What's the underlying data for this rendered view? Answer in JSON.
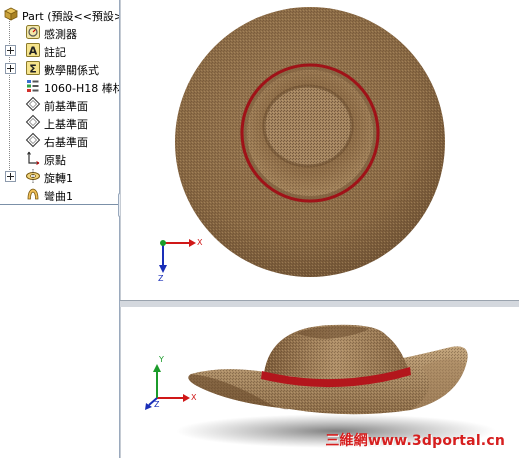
{
  "feature_tree": {
    "root_label": "Part (預設<<預設>",
    "items": [
      {
        "label": "感測器",
        "icon": "sensor-icon"
      },
      {
        "label": "註記",
        "icon": "annotation-icon"
      },
      {
        "label": "數學關係式",
        "icon": "equation-icon"
      },
      {
        "label": "1060-H18 棒材",
        "icon": "material-icon"
      },
      {
        "label": "前基準面",
        "icon": "plane-icon"
      },
      {
        "label": "上基準面",
        "icon": "plane-icon"
      },
      {
        "label": "右基準面",
        "icon": "plane-icon"
      },
      {
        "label": "原點",
        "icon": "origin-icon"
      },
      {
        "label": "旋轉1",
        "icon": "revolve-icon"
      },
      {
        "label": "彎曲1",
        "icon": "flex-icon"
      }
    ]
  },
  "top_view": {
    "triad": {
      "x": "X",
      "z": "Z"
    }
  },
  "iso_view": {
    "triad": {
      "x": "X",
      "y": "Y",
      "z": "Z"
    }
  },
  "watermark": "三維網www.3dportal.cn",
  "colors": {
    "straw": "#8f6a42",
    "band": "#b3161c",
    "axis_x": "#d01818",
    "axis_y": "#1b9b2a",
    "axis_z": "#1a2fb8"
  }
}
